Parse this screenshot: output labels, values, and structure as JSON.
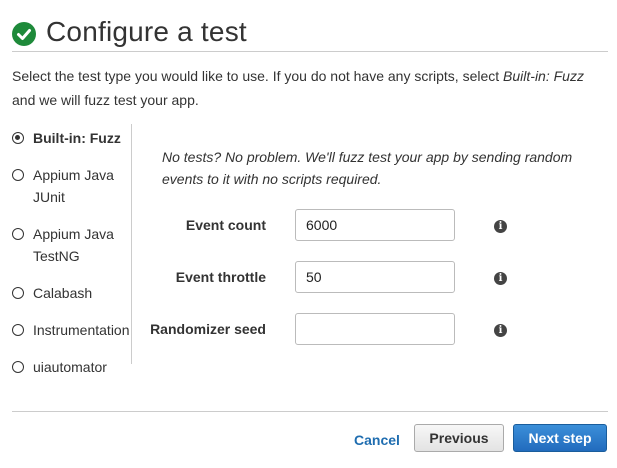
{
  "header": {
    "title": "Configure a test",
    "icon": "check-circle-icon",
    "icon_color": "#1e8a3a"
  },
  "intro": {
    "text_before": "Select the test type you would like to use. If you do not have any scripts, select ",
    "emphasis": "Built-in: Fuzz",
    "text_line2": "and we will fuzz test your app."
  },
  "test_types": [
    {
      "label": "Built-in: Fuzz",
      "selected": true
    },
    {
      "label": "Appium Java JUnit",
      "selected": false
    },
    {
      "label": "Appium Java TestNG",
      "selected": false
    },
    {
      "label": "Calabash",
      "selected": false
    },
    {
      "label": "Instrumentation",
      "selected": false
    },
    {
      "label": "uiautomator",
      "selected": false
    }
  ],
  "description": "No tests? No problem. We'll fuzz test your app by sending random events to it with no scripts required.",
  "fields": {
    "event_count": {
      "label": "Event count",
      "value": "6000"
    },
    "event_throttle": {
      "label": "Event throttle",
      "value": "50"
    },
    "randomizer_seed": {
      "label": "Randomizer seed",
      "value": ""
    }
  },
  "footer": {
    "cancel_label": "Cancel",
    "previous_label": "Previous",
    "next_label": "Next step",
    "link_color": "#1f6db0",
    "primary_color": "#226bbd"
  }
}
